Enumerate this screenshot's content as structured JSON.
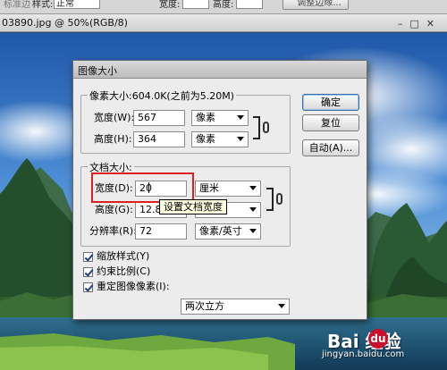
{
  "options_bar": {
    "style_label": "样式:",
    "style_value": "正常",
    "width_label": "宽度:",
    "height_label": "高度:",
    "refine_edge": "调整边缘..."
  },
  "document": {
    "tab_title": "03890.jpg @ 50%(RGB/8)"
  },
  "dialog": {
    "title": "图像大小",
    "pixel_dimensions": {
      "legend": "像素大小:604.0K(之前为5.20M)",
      "width_label": "宽度(W):",
      "width_value": "567",
      "width_unit": "像素",
      "height_label": "高度(H):",
      "height_value": "364",
      "height_unit": "像素"
    },
    "document_size": {
      "legend": "文档大小:",
      "width_label": "宽度(D):",
      "width_value": "20",
      "width_unit": "厘米",
      "height_label": "高度(G):",
      "height_value": "12.83",
      "height_unit": "厘米",
      "resolution_label": "分辨率(R):",
      "resolution_value": "72",
      "resolution_unit": "像素/英寸"
    },
    "buttons": {
      "ok": "确定",
      "reset": "复位",
      "auto": "自动(A)..."
    },
    "options": {
      "scale_styles": "缩放样式(Y)",
      "constrain_proportions": "约束比例(C)",
      "resample_image": "重定图像像素(I):",
      "resample_method": "两次立方"
    },
    "tooltip": "设置文档宽度"
  },
  "watermark": {
    "brand": "Bai  经验",
    "paw": "du",
    "url": "jingyan.baidu.com"
  }
}
